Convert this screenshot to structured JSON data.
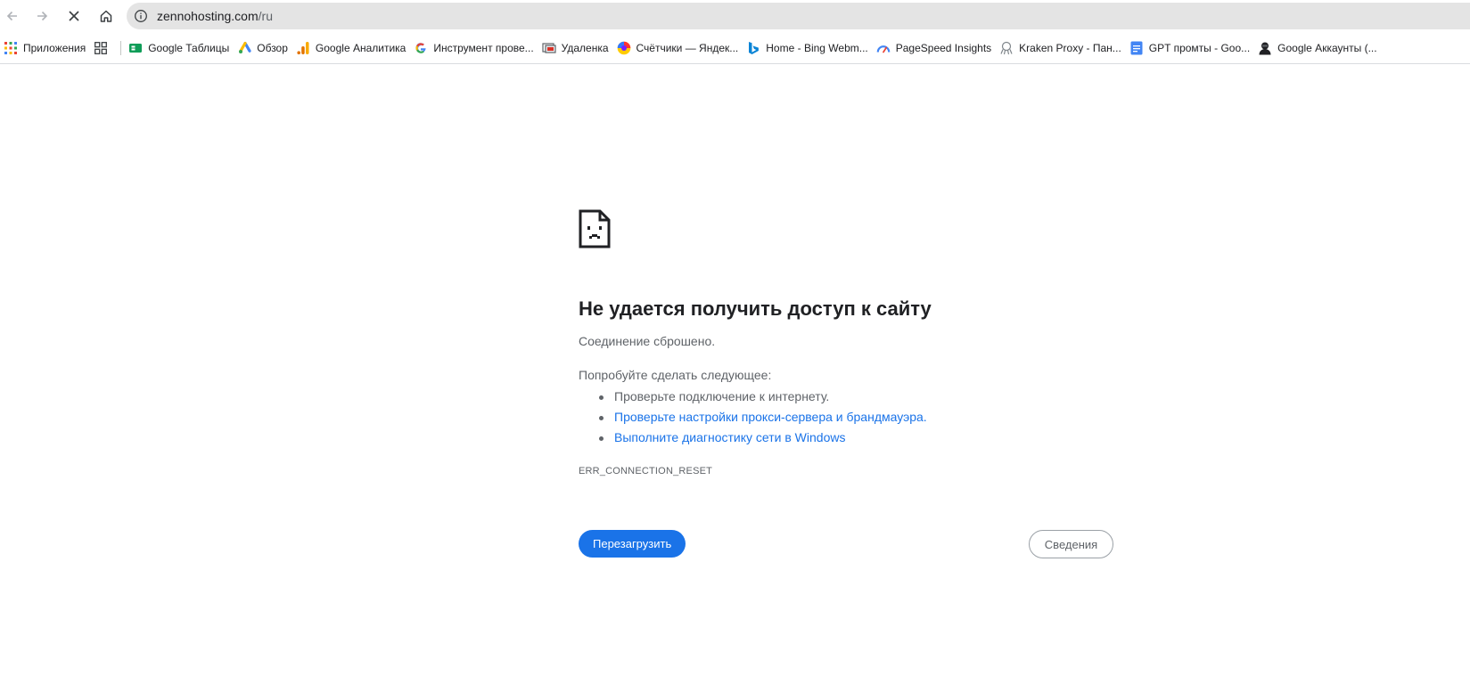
{
  "address_bar": {
    "host": "zennohosting.com",
    "path": "/ru"
  },
  "bookmarks": [
    {
      "label": "Приложения",
      "icon": "apps-grid-icon"
    },
    {
      "label": "",
      "icon": "tab-groups-icon"
    },
    {
      "label": "Google Таблицы",
      "icon": "google-sheets-icon"
    },
    {
      "label": "Обзор",
      "icon": "google-ads-icon"
    },
    {
      "label": "Google Аналитика",
      "icon": "google-analytics-icon"
    },
    {
      "label": "Инструмент прове...",
      "icon": "google-g-icon"
    },
    {
      "label": "Удаленка",
      "icon": "remote-desktop-icon"
    },
    {
      "label": "Счётчики — Яндек...",
      "icon": "yandex-metrica-icon"
    },
    {
      "label": "Home - Bing Webm...",
      "icon": "bing-icon"
    },
    {
      "label": "PageSpeed Insights",
      "icon": "pagespeed-icon"
    },
    {
      "label": "Kraken Proxy - Пан...",
      "icon": "kraken-icon"
    },
    {
      "label": "GPT промты - Goo...",
      "icon": "google-docs-icon"
    },
    {
      "label": "Google Аккаунты (...",
      "icon": "google-account-icon"
    }
  ],
  "error": {
    "title": "Не удается получить доступ к сайту",
    "description": "Соединение сброшено.",
    "try_heading": "Попробуйте сделать следующее:",
    "suggestions": [
      "Проверьте подключение к интернету.",
      "Проверьте настройки прокси-сервера и брандмауэра.",
      "Выполните диагностику сети в Windows"
    ],
    "code": "ERR_CONNECTION_RESET"
  },
  "buttons": {
    "reload": "Перезагрузить",
    "details": "Сведения"
  },
  "colors": {
    "accent": "#1a73e8",
    "omnibox_bg": "#e4e4e4",
    "secondary_text": "#5f6368"
  }
}
